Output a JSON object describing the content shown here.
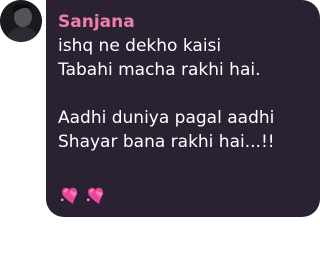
{
  "message": {
    "sender_name": "Sanjana",
    "lines": [
      "ishq ne dekho kaisi",
      "Tabahi macha rakhi hai.",
      "Aadhi duniya pagal aadhi",
      "Shayar bana rakhi hai...!!"
    ],
    "emojis": [
      "revolving-hearts-icon",
      "revolving-hearts-icon"
    ]
  },
  "colors": {
    "bubble": "#2a2232",
    "sender": "#ef7fa8",
    "text": "#ffffff",
    "heart": "#e8479a"
  }
}
